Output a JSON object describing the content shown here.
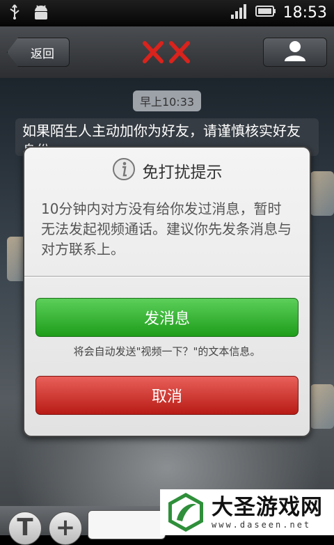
{
  "status_bar": {
    "time": "18:53",
    "icons": [
      "usb-icon",
      "android-icon",
      "signal-icon",
      "battery-icon"
    ]
  },
  "header": {
    "back_label": "返回",
    "title_marks": "✕✕",
    "title_mark_color": "#d9231c"
  },
  "chat": {
    "timestamp": "早上10:33",
    "notice": "如果陌生人主动加你为好友，请谨慎核实好友身份"
  },
  "dialog": {
    "title": "免打扰提示",
    "message": "10分钟内对方没有给你发过消息，暂时无法发起视频通话。建议你先发条消息与对方联系上。",
    "primary_label": "发消息",
    "hint": "将会自动发送\"视频一下？\"的文本信息。",
    "cancel_label": "取消",
    "colors": {
      "primary": "#2aa827",
      "cancel": "#c92a23"
    }
  },
  "bottom_bar": {
    "left_icon": "text-toggle-icon",
    "plus_icon": "plus-icon"
  },
  "watermark": {
    "name": "大圣游戏网",
    "url": "www.daseen.net"
  }
}
